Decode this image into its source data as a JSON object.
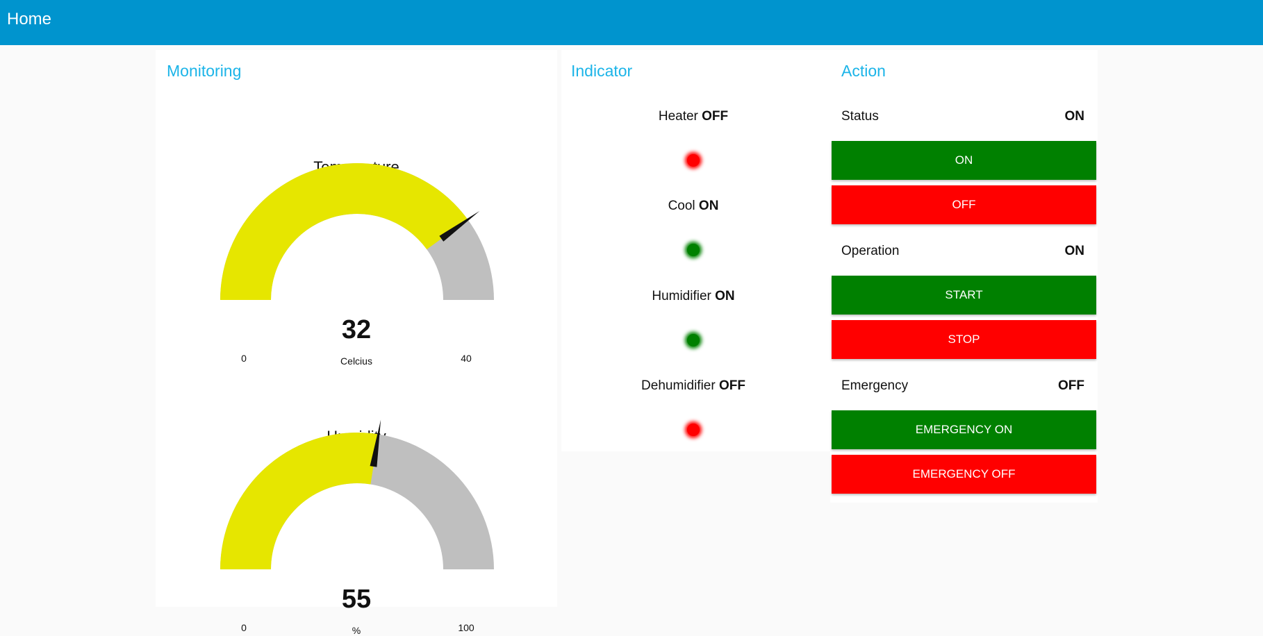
{
  "header": {
    "title": "Home"
  },
  "colors": {
    "header_bg": "#0094ce",
    "title_blue": "#1bb4e8",
    "gauge_fill": "#e6e600",
    "gauge_track": "#bfbfbf",
    "on_green": "#008000",
    "off_red": "#ff0000"
  },
  "monitoring": {
    "title": "Monitoring",
    "gauges": [
      {
        "label": "Temperature",
        "value": 32,
        "units": "Celcius",
        "min": 0,
        "max": 40
      },
      {
        "label": "Humidity",
        "value": 55,
        "units": "%",
        "min": 0,
        "max": 100
      }
    ]
  },
  "indicator": {
    "title": "Indicator",
    "items": [
      {
        "name": "Heater",
        "state": "OFF",
        "color": "#ff0000"
      },
      {
        "name": "Cool",
        "state": "ON",
        "color": "#008000"
      },
      {
        "name": "Humidifier",
        "state": "ON",
        "color": "#008000"
      },
      {
        "name": "Dehumidifier",
        "state": "OFF",
        "color": "#ff0000"
      }
    ]
  },
  "action": {
    "title": "Action",
    "groups": [
      {
        "label": "Status",
        "state": "ON",
        "on_label": "ON",
        "off_label": "OFF"
      },
      {
        "label": "Operation",
        "state": "ON",
        "on_label": "START",
        "off_label": "STOP"
      },
      {
        "label": "Emergency",
        "state": "OFF",
        "on_label": "EMERGENCY ON",
        "off_label": "EMERGENCY OFF"
      }
    ]
  }
}
